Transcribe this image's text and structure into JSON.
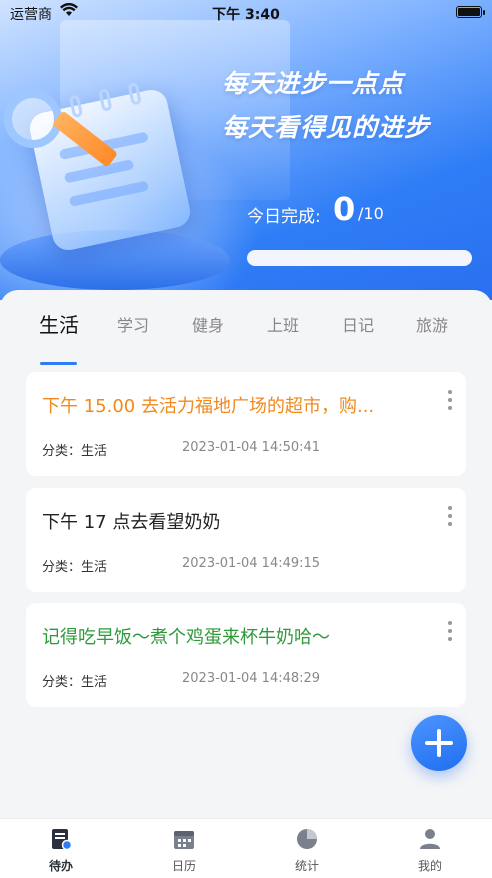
{
  "status_bar": {
    "carrier": "运营商",
    "time": "下午 3:40"
  },
  "hero": {
    "slogan_line1": "每天进步一点点",
    "slogan_line2": "每天看得见的进步",
    "done_label": "今日完成:",
    "done_count": "0",
    "done_total": "/10",
    "progress_fraction": 0
  },
  "tabs": [
    {
      "label": "生活"
    },
    {
      "label": "学习"
    },
    {
      "label": "健身"
    },
    {
      "label": "上班"
    },
    {
      "label": "日记"
    },
    {
      "label": "旅游"
    }
  ],
  "tasks": [
    {
      "title": "下午 15.00 去活力福地广场的超市，购...",
      "category": "分类：生活",
      "timestamp": "2023-01-04 14:50:41",
      "color": "#f08a1c"
    },
    {
      "title": "下午 17 点去看望奶奶",
      "category": "分类：生活",
      "timestamp": "2023-01-04 14:49:15",
      "color": "#222222"
    },
    {
      "title": "记得吃早饭～煮个鸡蛋来杯牛奶哈～",
      "category": "分类：生活",
      "timestamp": "2023-01-04 14:48:29",
      "color": "#2e9a3a"
    }
  ],
  "bottom_nav": [
    {
      "label": "待办",
      "icon": "todo-icon"
    },
    {
      "label": "日历",
      "icon": "calendar-icon"
    },
    {
      "label": "统计",
      "icon": "pie-chart-icon"
    },
    {
      "label": "我的",
      "icon": "user-icon"
    }
  ],
  "colors": {
    "accent": "#2f7df6",
    "active_nav": "#2a3040"
  }
}
